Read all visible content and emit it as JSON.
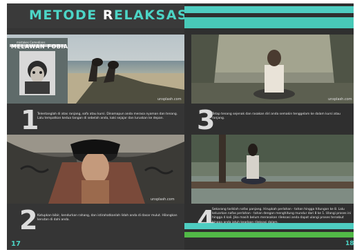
{
  "title": {
    "part1": "METODE ",
    "cap": "R",
    "part2": "ELAKSASI"
  },
  "book_cover": {
    "line1": "mistakes Comedians",
    "line2": "MELAWAN FOBIA"
  },
  "watermark": "unsplash.com",
  "steps": [
    {
      "number": "1",
      "text": "Telentanglah di atas ranjang, sofa atau kursi. Dinamapun anda merasa nyaman dan tenang. Lalu tempatkan kedua tangan di sebelah anda, kaki sejajar dan luruskan ke depan."
    },
    {
      "number": "2",
      "text": "Katupkan bibir, kendurkan rahang, dan istirahatkanlah lidah anda di dasar mulut. Hilangkan kerutan di dahi anda."
    },
    {
      "number": "3",
      "text": "Tetap tenang sejenak dan rasakan diri anda semakin tenggelam ke dalam kursi atau ranjang."
    },
    {
      "number": "4",
      "text": "Sekarang tariklah nafas panjang. Hirupkah perlahan - tahan hingga hitungan ke 8. Lalu keluarkan nafas perlahan - tahan dengan menghitung mundur dari 8 ke 1. Ulangi proses ini hingga 4 kali. Jika masih belum merasakan rileksasi anda dapat ulangi proses tersebut hingga anda jatuh keadaan rileksasi dalam."
    }
  ],
  "page_numbers": {
    "left": "17",
    "right": "18"
  },
  "colors": {
    "accent": "#4cd5c6",
    "green": "#52b947",
    "page_bg": "#353535"
  }
}
